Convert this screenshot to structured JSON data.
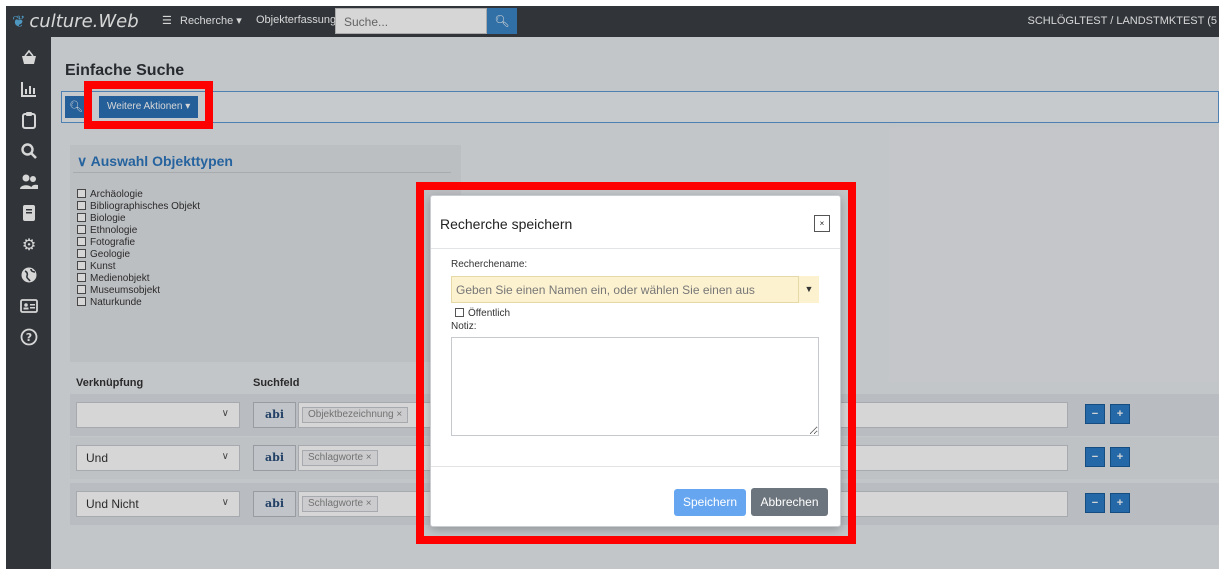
{
  "topbar": {
    "brand": "culture.Web",
    "nav_recherche": "Recherche",
    "nav_objekterfassung": "Objekterfassung",
    "search_placeholder": "Suche...",
    "user": "SCHLÖGLTEST / LANDSTMKTEST (5"
  },
  "sidebar": {
    "icons": [
      "basket-icon",
      "chart-icon",
      "clipboard-icon",
      "search-icon",
      "users-icon",
      "book-icon",
      "gear-icon",
      "globe-icon",
      "id-card-icon",
      "help-icon"
    ]
  },
  "main": {
    "title": "Einfache Suche",
    "actions_label": "Weitere Aktionen",
    "objecttypes": {
      "heading": "Auswahl Objekttypen",
      "items": [
        "Archäologie",
        "Bibliographisches Objekt",
        "Biologie",
        "Ethnologie",
        "Fotografie",
        "Geologie",
        "Kunst",
        "Medienobjekt",
        "Museumsobjekt",
        "Naturkunde"
      ]
    },
    "columns": {
      "link": "Verknüpfung",
      "field": "Suchfeld"
    },
    "rows": [
      {
        "link": "",
        "field": "Objektbezeichnung"
      },
      {
        "link": "Und",
        "field": "Schlagworte"
      },
      {
        "link": "Und Nicht",
        "field": "Schlagworte"
      }
    ],
    "abi_label": "abi"
  },
  "modal": {
    "title": "Recherche speichern",
    "close": "×",
    "name_label": "Recherchename:",
    "name_placeholder": "Geben Sie einen Namen ein, oder wählen Sie einen aus",
    "public_label": "Öffentlich",
    "note_label": "Notiz:",
    "save": "Speichern",
    "cancel": "Abbrechen"
  },
  "colors": {
    "highlight": "#ff0000",
    "primary": "#2b72b8",
    "dark": "#3b4046"
  }
}
